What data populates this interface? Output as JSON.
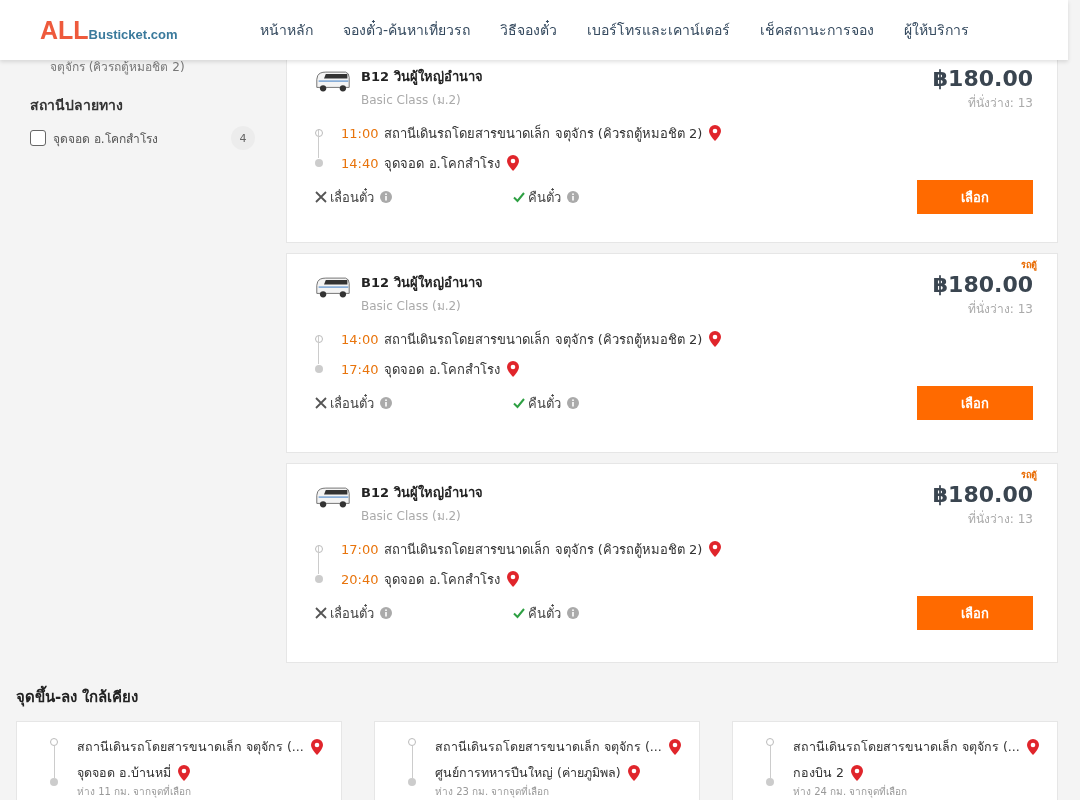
{
  "header": {
    "logo_main": "ALL",
    "logo_sub": "Busticket.com",
    "nav": [
      {
        "label": "หน้าหลัก"
      },
      {
        "label": "จองตั๋ว-ค้นหาเที่ยวรถ"
      },
      {
        "label": "วิธีจองตั๋ว"
      },
      {
        "label": "เบอร์โทรและเคาน์เตอร์"
      },
      {
        "label": "เช็คสถานะการจอง"
      },
      {
        "label": "ผู้ให้บริการ"
      }
    ]
  },
  "sidebar": {
    "cut_text": "จตุจักร (คิวรถตู้หมอชิต 2)",
    "heading": "สถานีปลายทาง",
    "filters": [
      {
        "label": "จุดจอด อ.โคกสำโรง",
        "count": "4",
        "checked": false
      }
    ]
  },
  "trips": [
    {
      "operator": "B12 วินผู้ใหญ่อำนาจ",
      "class": "Basic Class (ม.2)",
      "price": "฿180.00",
      "seats": "ที่นั่งว่าง: 13",
      "stops": [
        {
          "time": "11:00",
          "place": "สถานีเดินรถโดยสารขนาดเล็ก จตุจักร (คิวรถตู้หมอชิต 2)"
        },
        {
          "time": "14:40",
          "place": "จุดจอด อ.โคกสำโรง"
        }
      ],
      "policies": [
        {
          "label": "เลื่อนตั๋ว",
          "allowed": false
        },
        {
          "label": "คืนตั๋ว",
          "allowed": true
        }
      ],
      "button": "เลือก"
    },
    {
      "badge": "รถตู้",
      "operator": "B12 วินผู้ใหญ่อำนาจ",
      "class": "Basic Class (ม.2)",
      "price": "฿180.00",
      "seats": "ที่นั่งว่าง: 13",
      "stops": [
        {
          "time": "14:00",
          "place": "สถานีเดินรถโดยสารขนาดเล็ก จตุจักร (คิวรถตู้หมอชิต 2)"
        },
        {
          "time": "17:40",
          "place": "จุดจอด อ.โคกสำโรง"
        }
      ],
      "policies": [
        {
          "label": "เลื่อนตั๋ว",
          "allowed": false
        },
        {
          "label": "คืนตั๋ว",
          "allowed": true
        }
      ],
      "button": "เลือก"
    },
    {
      "badge": "รถตู้",
      "operator": "B12 วินผู้ใหญ่อำนาจ",
      "class": "Basic Class (ม.2)",
      "price": "฿180.00",
      "seats": "ที่นั่งว่าง: 13",
      "stops": [
        {
          "time": "17:00",
          "place": "สถานีเดินรถโดยสารขนาดเล็ก จตุจักร (คิวรถตู้หมอชิต 2)"
        },
        {
          "time": "20:40",
          "place": "จุดจอด อ.โคกสำโรง"
        }
      ],
      "policies": [
        {
          "label": "เลื่อนตั๋ว",
          "allowed": false
        },
        {
          "label": "คืนตั๋ว",
          "allowed": true
        }
      ],
      "button": "เลือก"
    }
  ],
  "nearby": {
    "heading": "จุดขึ้น-ลง ใกล้เคียง",
    "items": [
      {
        "from": "สถานีเดินรถโดยสารขนาดเล็ก จตุจักร (...",
        "to": "จุดจอด อ.บ้านหมี่",
        "distance": "ห่าง 11 กม. จากจุดที่เลือก"
      },
      {
        "from": "สถานีเดินรถโดยสารขนาดเล็ก จตุจักร (...",
        "to": "ศูนย์การทหารปืนใหญ่ (ค่ายภูมิพล)",
        "distance": "ห่าง 23 กม. จากจุดที่เลือก"
      },
      {
        "from": "สถานีเดินรถโดยสารขนาดเล็ก จตุจักร (...",
        "to": "กองบิน 2",
        "distance": "ห่าง 24 กม. จากจุดที่เลือก"
      }
    ]
  }
}
